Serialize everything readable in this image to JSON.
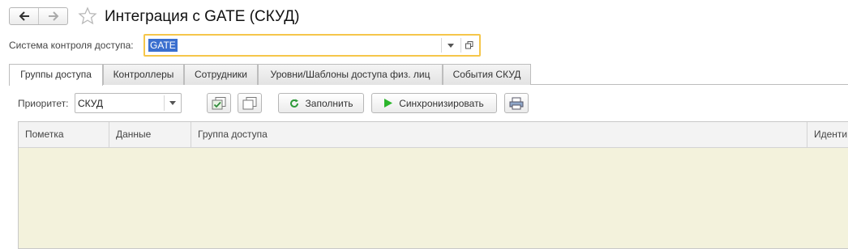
{
  "window": {
    "title": "Интеграция с GATE (СКУД)"
  },
  "nav": {
    "back_icon": "arrow-left-icon",
    "forward_icon": "arrow-right-icon",
    "favorite_icon": "star-icon"
  },
  "access_system": {
    "label": "Система контроля доступа:",
    "value": "GATE"
  },
  "tabs": [
    {
      "label": "Группы доступа",
      "active": true
    },
    {
      "label": "Контроллеры",
      "active": false
    },
    {
      "label": "Сотрудники",
      "active": false
    },
    {
      "label": "Уровни/Шаблоны доступа физ. лиц",
      "active": false
    },
    {
      "label": "События СКУД",
      "active": false
    }
  ],
  "toolbar": {
    "priority_label": "Приоритет:",
    "priority_value": "СКУД",
    "fill_label": "Заполнить",
    "sync_label": "Синхронизировать"
  },
  "table": {
    "columns": [
      "Пометка",
      "Данные",
      "Группа доступа",
      "Иденти"
    ],
    "rows": []
  },
  "colors": {
    "focus_border": "#f5c64a",
    "selection": "#3a6fcf",
    "table_bg": "#f3f2dc",
    "sync_icon": "#2bb52b",
    "refresh_icon": "#2e9a3a"
  }
}
